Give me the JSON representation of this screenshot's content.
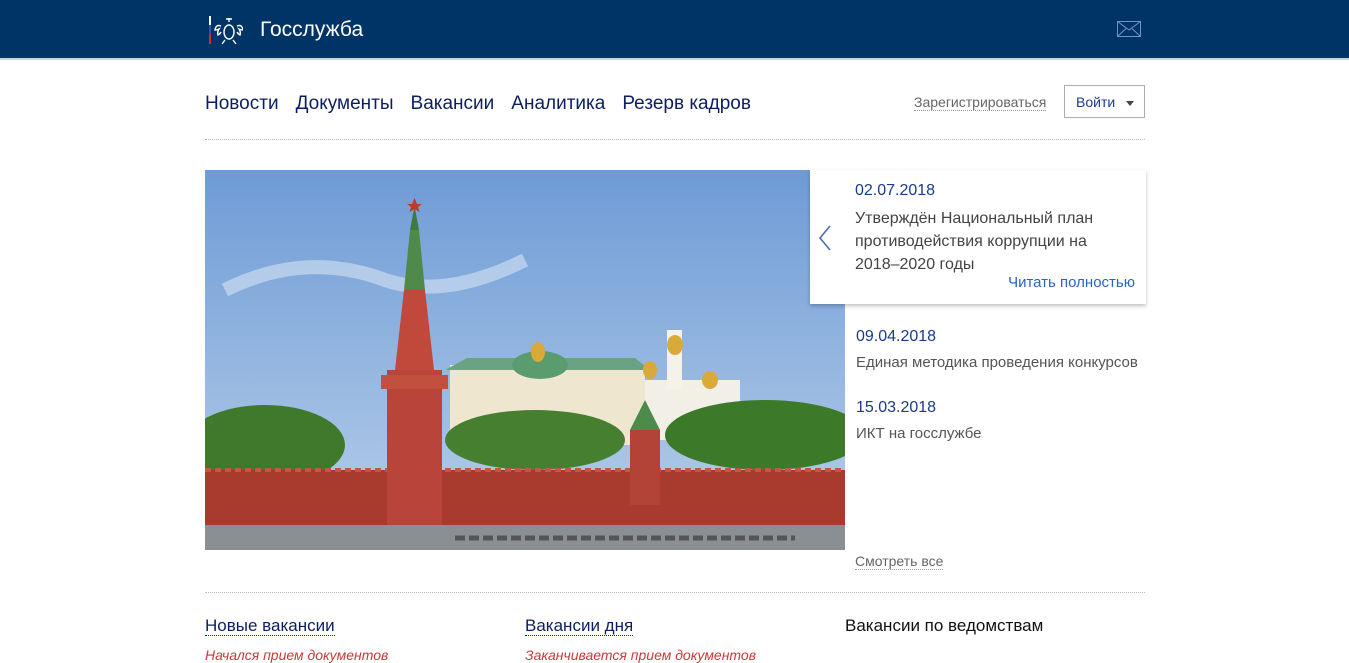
{
  "header": {
    "brand": "Госслужба",
    "logo_icon": "coat-of-arms-icon",
    "mail_icon": "mail-icon"
  },
  "nav": {
    "items": [
      "Новости",
      "Документы",
      "Вакансии",
      "Аналитика",
      "Резерв кадров"
    ]
  },
  "auth": {
    "register": "Зарегистрироваться",
    "login": "Войти"
  },
  "featured": {
    "date": "02.07.2018",
    "title": "Утверждён Национальный план противодействия коррупции на 2018–2020 годы",
    "read_more": "Читать полностью"
  },
  "news": [
    {
      "date": "09.04.2018",
      "title": "Единая методика проведения конкурсов"
    },
    {
      "date": "15.03.2018",
      "title": "ИКТ на госслужбе"
    }
  ],
  "see_all": "Смотреть все",
  "sections": [
    {
      "title": "Новые вакансии",
      "sub": "Начался прием документов"
    },
    {
      "title": "Вакансии дня",
      "sub": "Заканчивается прием документов"
    },
    {
      "title": "Вакансии по ведомствам",
      "sub": ""
    }
  ],
  "colors": {
    "header_bg": "#003366",
    "nav_text": "#0b1f5e",
    "link": "#2a62c6",
    "accent_red": "#c83a3a"
  }
}
